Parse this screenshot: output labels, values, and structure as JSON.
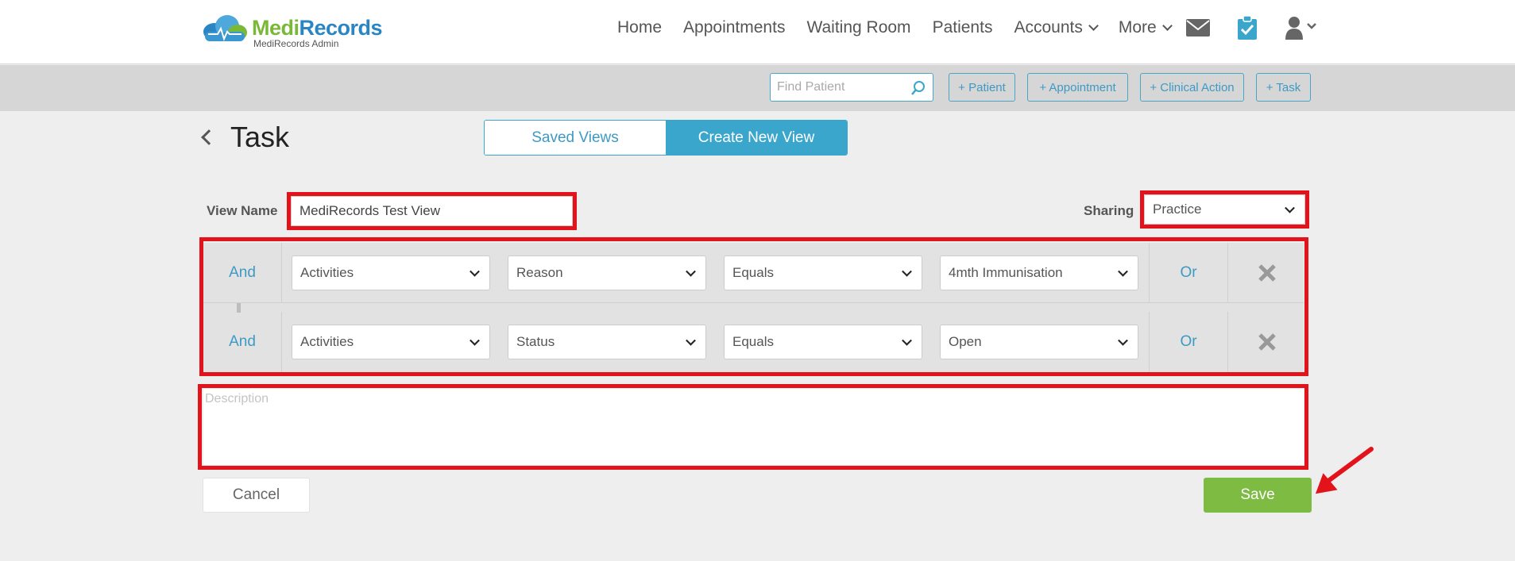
{
  "brand": {
    "name_part1": "Medi",
    "name_part2": "Records",
    "subtitle": "MediRecords Admin"
  },
  "nav": {
    "items": [
      {
        "label": "Home",
        "dropdown": false
      },
      {
        "label": "Appointments",
        "dropdown": false
      },
      {
        "label": "Waiting Room",
        "dropdown": false
      },
      {
        "label": "Patients",
        "dropdown": false
      },
      {
        "label": "Accounts",
        "dropdown": true
      },
      {
        "label": "More",
        "dropdown": true
      }
    ],
    "icons": [
      "mail-icon",
      "clipboard-check-icon",
      "user-icon"
    ]
  },
  "toolbar": {
    "find_placeholder": "Find Patient",
    "buttons": [
      "+ Patient",
      "+ Appointment",
      "+ Clinical Action",
      "+ Task"
    ]
  },
  "page": {
    "title": "Task"
  },
  "view_tabs": {
    "saved": "Saved Views",
    "create": "Create New View",
    "active": "Create New View"
  },
  "form": {
    "view_name_label": "View Name",
    "view_name_value": "MediRecords Test View",
    "sharing_label": "Sharing",
    "sharing_value": "Practice",
    "description_placeholder": "Description",
    "cancel_label": "Cancel",
    "save_label": "Save"
  },
  "filters": [
    {
      "connector": "And",
      "field": "Activities",
      "attribute": "Reason",
      "operator": "Equals",
      "value": "4mth Immunisation",
      "or_label": "Or"
    },
    {
      "connector": "And",
      "field": "Activities",
      "attribute": "Status",
      "operator": "Equals",
      "value": "Open",
      "or_label": "Or"
    }
  ],
  "colors": {
    "accent": "#3aa6cc",
    "save_green": "#7dbb42",
    "highlight_red": "#e3131b",
    "brand_green": "#7ab83a",
    "brand_blue": "#2a86c3"
  }
}
